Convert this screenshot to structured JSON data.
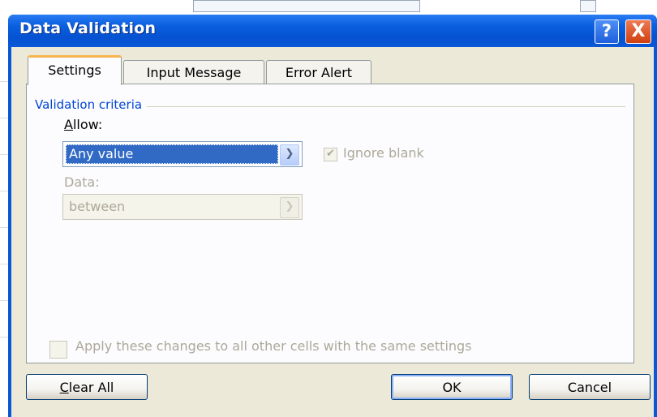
{
  "dialog": {
    "title": "Data Validation",
    "help_glyph": "?",
    "close_glyph": "X"
  },
  "tabs": [
    {
      "label": "Settings",
      "selected": true
    },
    {
      "label": "Input Message",
      "selected": false
    },
    {
      "label": "Error Alert",
      "selected": false
    }
  ],
  "settings": {
    "group_label": "Validation criteria",
    "allow": {
      "label_first": "A",
      "label_rest": "llow:",
      "value": "Any value"
    },
    "ignore_blank": {
      "label": "Ignore blank",
      "checked": true,
      "enabled": false
    },
    "data": {
      "label": "Data:",
      "value": "between",
      "enabled": false
    },
    "apply_all": {
      "label": "Apply these changes to all other cells with the same settings",
      "checked": false,
      "enabled": false
    }
  },
  "buttons": {
    "clear_all_first": "C",
    "clear_all_rest": "lear All",
    "ok": "OK",
    "cancel": "Cancel"
  },
  "icons": {
    "dropdown": "chevron-down-icon",
    "check": "checkmark-icon"
  },
  "colors": {
    "title_bar": "#0a58d6",
    "selection": "#316ac5",
    "tab_highlight": "#f7b44e",
    "group_label": "#0046d5",
    "close_button": "#d0410f"
  }
}
